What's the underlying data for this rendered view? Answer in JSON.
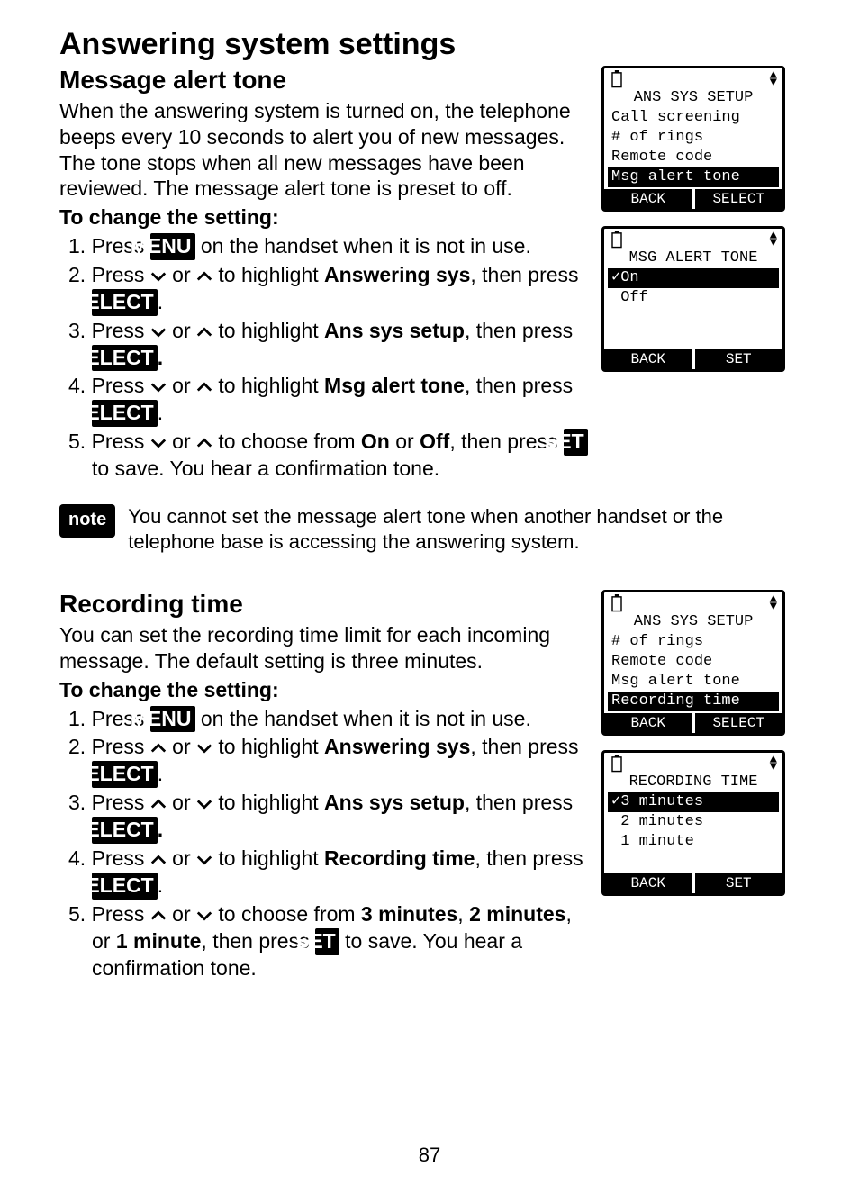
{
  "page_number": "87",
  "title": "Answering system settings",
  "section1": {
    "heading": "Message alert tone",
    "intro": "When the answering system is turned on, the telephone beeps every 10 seconds to alert you of new messages. The tone stops when all new messages have been reviewed. The message alert tone is preset to off.",
    "subheading": "To change the setting:",
    "steps": {
      "s1": {
        "num": "1.",
        "a": "Press ",
        "btn": "MENU",
        "b": " on the handset when it is not in use."
      },
      "s2": {
        "num": "2.",
        "a": "Press ",
        "mid": " or ",
        "b": " to highlight ",
        "bold": "Answering sys",
        "c": ", then press ",
        "btn": "SELECT",
        "d": "."
      },
      "s3": {
        "num": "3.",
        "a": "Press ",
        "mid": " or ",
        "b": " to highlight ",
        "bold": "Ans sys setup",
        "c": ", then press ",
        "btn": "SELECT",
        "d": "."
      },
      "s4": {
        "num": "4.",
        "a": "Press ",
        "mid": " or ",
        "b": " to highlight ",
        "bold": "Msg alert tone",
        "c": ", then press ",
        "btn": "SELECT",
        "d": "."
      },
      "s5": {
        "num": "5.",
        "a": "Press ",
        "mid": " or ",
        "b": " to choose from ",
        "bold1": "On",
        "c": " or ",
        "bold2": "Off",
        "d": ", then press ",
        "btn": "SET",
        "e": " to save. You hear a confirmation tone."
      }
    },
    "lcd1": {
      "title": "ANS SYS SETUP",
      "l1": "Call screening",
      "l2": "# of rings",
      "l3": "Remote code",
      "hl": "Msg alert tone",
      "softL": "BACK",
      "softR": "SELECT"
    },
    "lcd2": {
      "title": "MSG ALERT TONE",
      "hl": "✓On",
      "l1": " Off",
      "softL": "BACK",
      "softR": "SET"
    }
  },
  "note": {
    "label": "note",
    "text": "You cannot set the message alert tone when another handset or the telephone base is accessing the answering system."
  },
  "section2": {
    "heading": "Recording time",
    "intro": "You can set the recording time limit for each incoming message. The default setting is three minutes.",
    "subheading": "To change the setting:",
    "steps": {
      "s1": {
        "num": "1.",
        "a": "Press ",
        "btn": "MENU",
        "b": " on the handset when it is not in use."
      },
      "s2": {
        "num": "2.",
        "a": "Press ",
        "mid": " or ",
        "b": " to highlight ",
        "bold": "Answering sys",
        "c": ", then press ",
        "btn": "SELECT",
        "d": "."
      },
      "s3": {
        "num": "3.",
        "a": "Press ",
        "mid": " or ",
        "b": " to highlight ",
        "bold": "Ans sys setup",
        "c": ", then press ",
        "btn": "SELECT",
        "d": "."
      },
      "s4": {
        "num": "4.",
        "a": "Press ",
        "mid": " or ",
        "b": " to highlight ",
        "bold": "Recording time",
        "c": ", then press ",
        "btn": "SELECT",
        "d": "."
      },
      "s5": {
        "num": "5.",
        "a": "Press ",
        "mid": " or ",
        "b": " to choose from ",
        "bold1": "3 minutes",
        "c": ", ",
        "bold2": "2 minutes",
        "d": ", or ",
        "bold3": "1 minute",
        "e": ", then press ",
        "btn": "SET",
        "f": " to save. You hear a confirmation tone."
      }
    },
    "lcd1": {
      "title": "ANS SYS SETUP",
      "l1": "# of rings",
      "l2": "Remote code",
      "l3": "Msg alert tone",
      "hl": "Recording time",
      "softL": "BACK",
      "softR": "SELECT"
    },
    "lcd2": {
      "title": "RECORDING TIME",
      "hl": "✓3 minutes",
      "l1": " 2 minutes",
      "l2": " 1 minute",
      "softL": "BACK",
      "softR": "SET"
    }
  }
}
